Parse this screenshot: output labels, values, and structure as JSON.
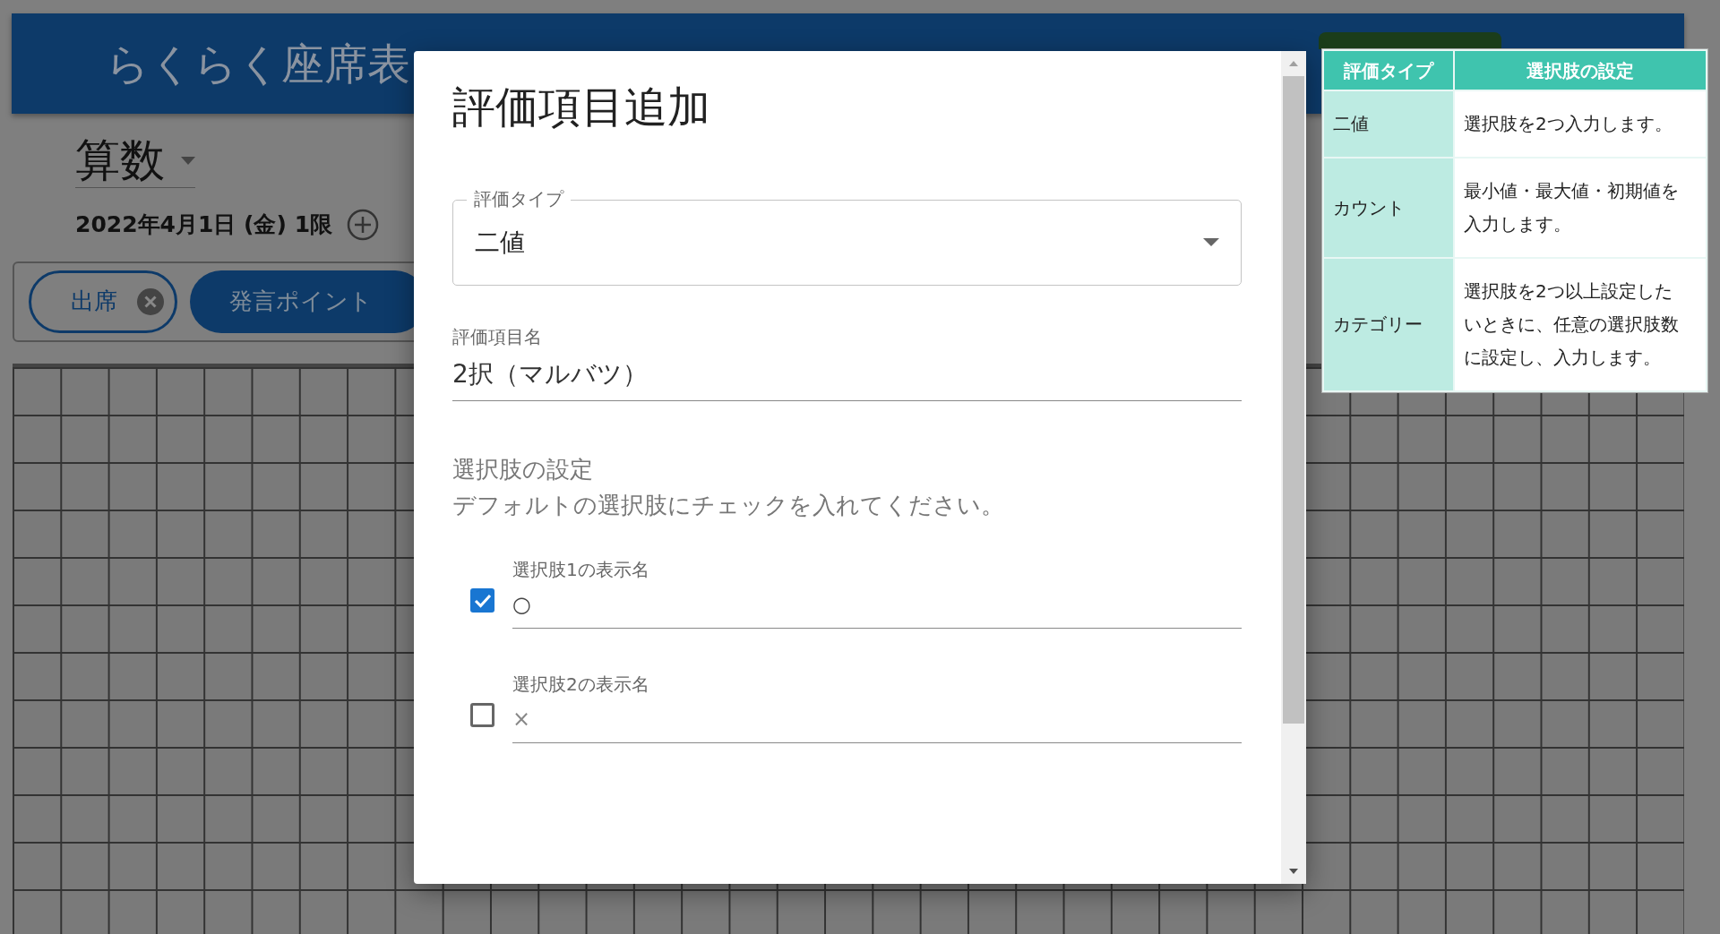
{
  "app_bar": {
    "title": "らくらく座席表"
  },
  "subject": {
    "value": "算数"
  },
  "session": {
    "label": "2022年4月1日 (金) 1限"
  },
  "chips": [
    {
      "label": "出席",
      "selected": false
    },
    {
      "label": "発言ポイント",
      "selected": true
    }
  ],
  "dialog": {
    "title": "評価項目追加",
    "type_field": {
      "label": "評価タイプ",
      "value": "二値"
    },
    "name_field": {
      "label": "評価項目名",
      "value": "2択（マルバツ）"
    },
    "options_heading": "選択肢の設定",
    "options_hint": "デフォルトの選択肢にチェックを入れてください。",
    "options": [
      {
        "label": "選択肢1の表示名",
        "value": "○",
        "checked": true
      },
      {
        "label": "選択肢2の表示名",
        "value": "×",
        "checked": false
      }
    ]
  },
  "help_table": {
    "columns": [
      "評価タイプ",
      "選択肢の設定"
    ],
    "rows": [
      {
        "type": "二値",
        "description": "選択肢を2つ入力します。"
      },
      {
        "type": "カウント",
        "description": "最小値・最大値・初期値を入力します。"
      },
      {
        "type": "カテゴリー",
        "description": "選択肢を2つ以上設定したいときに、任意の選択肢数に設定し、入力します。"
      }
    ]
  }
}
